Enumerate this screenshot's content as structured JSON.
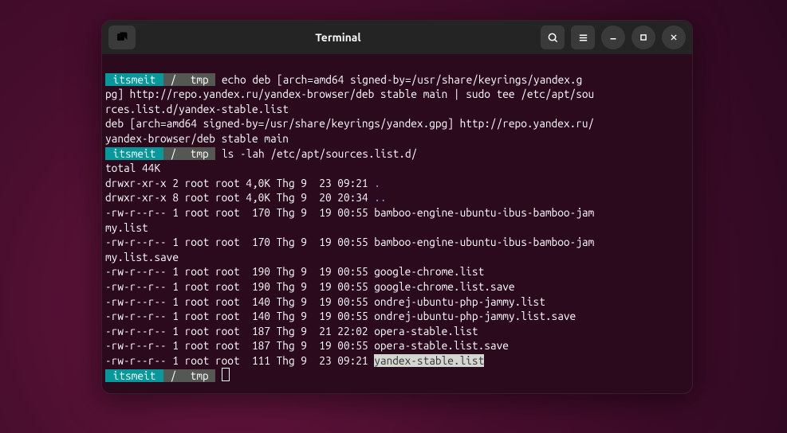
{
  "titlebar": {
    "title": "Terminal"
  },
  "prompt": {
    "user": " itsmeit ",
    "sep1": " / ",
    "path": " tmp ",
    "arrow_out": ""
  },
  "cmd1": " echo deb [arch=amd64 signed-by=/usr/share/keyrings/yandex.g",
  "out1a": "pg] http://repo.yandex.ru/yandex-browser/deb stable main | sudo tee /etc/apt/sou",
  "out1b": "rces.list.d/yandex-stable.list",
  "out1c": "deb [arch=amd64 signed-by=/usr/share/keyrings/yandex.gpg] http://repo.yandex.ru/",
  "out1d": "yandex-browser/deb stable main",
  "cmd2": " ls -lah /etc/apt/sources.list.d/",
  "ls": {
    "total": "total 44K",
    "r1a": "drwxr-xr-x 2 root root 4,0K Thg 9  23 09:21 ",
    "r1b": ".",
    "r2a": "drwxr-xr-x 8 root root 4,0K Thg 9  20 20:34 ",
    "r2b": "..",
    "r3a": "-rw-r--r-- 1 root root  170 Thg 9  19 00:55 bamboo-engine-ubuntu-ibus-bamboo-jam",
    "r3b": "my.list",
    "r4a": "-rw-r--r-- 1 root root  170 Thg 9  19 00:55 bamboo-engine-ubuntu-ibus-bamboo-jam",
    "r4b": "my.list.save",
    "r5": "-rw-r--r-- 1 root root  190 Thg 9  19 00:55 google-chrome.list",
    "r6": "-rw-r--r-- 1 root root  190 Thg 9  19 00:55 google-chrome.list.save",
    "r7": "-rw-r--r-- 1 root root  140 Thg 9  19 00:55 ondrej-ubuntu-php-jammy.list",
    "r8": "-rw-r--r-- 1 root root  140 Thg 9  19 00:55 ondrej-ubuntu-php-jammy.list.save",
    "r9": "-rw-r--r-- 1 root root  187 Thg 9  21 22:02 opera-stable.list",
    "r10": "-rw-r--r-- 1 root root  187 Thg 9  19 00:55 opera-stable.list.save",
    "r11a": "-rw-r--r-- 1 root root  111 Thg 9  23 09:21 ",
    "r11b": "yandex-stable.list"
  }
}
